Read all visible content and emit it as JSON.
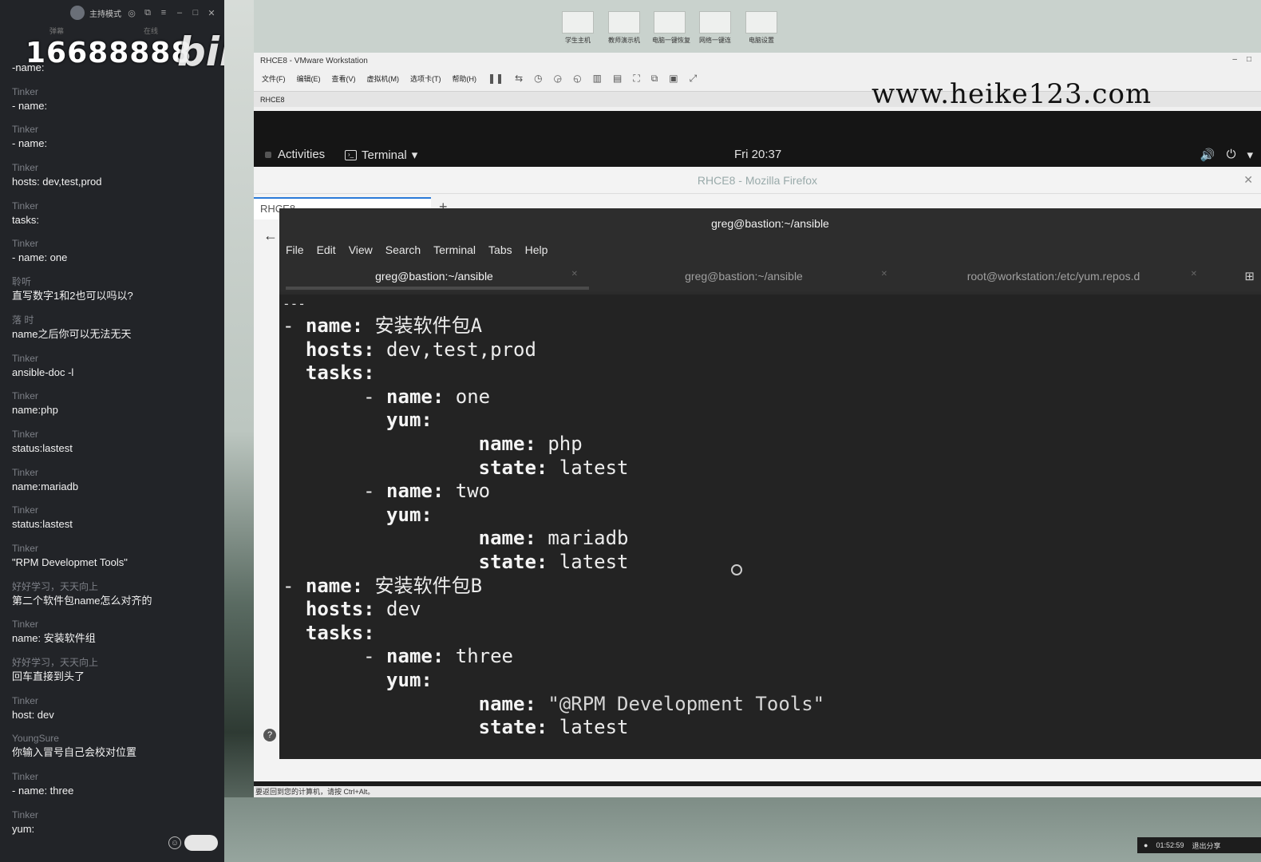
{
  "chat": {
    "host_label": "主持模式",
    "tabs": [
      "弹幕",
      "在线"
    ],
    "overlay_number": "16688888",
    "overlay_logo": "bili",
    "messages": [
      {
        "user": "",
        "text": "-name:"
      },
      {
        "user": "Tinker",
        "text": "- name:"
      },
      {
        "user": "Tinker",
        "text": "- name:"
      },
      {
        "user": "Tinker",
        "text": "hosts: dev,test,prod"
      },
      {
        "user": "Tinker",
        "text": "tasks:"
      },
      {
        "user": "Tinker",
        "text": "- name: one"
      },
      {
        "user": "聆听",
        "text": "直写数字1和2也可以吗以?"
      },
      {
        "user": "落 时",
        "text": "name之后你可以无法无天"
      },
      {
        "user": "Tinker",
        "text": "ansible-doc -l"
      },
      {
        "user": "Tinker",
        "text": "name:php"
      },
      {
        "user": "Tinker",
        "text": "status:lastest"
      },
      {
        "user": "Tinker",
        "text": "name:mariadb"
      },
      {
        "user": "Tinker",
        "text": "status:lastest"
      },
      {
        "user": "Tinker",
        "text": "\"RPM Developmet Tools\""
      },
      {
        "user": "好好学习，天天向上",
        "text": "第二个软件包name怎么对齐的"
      },
      {
        "user": "Tinker",
        "text": "name: 安装软件组"
      },
      {
        "user": "好好学习，天天向上",
        "text": "回车直接到头了"
      },
      {
        "user": "Tinker",
        "text": "host: dev"
      },
      {
        "user": "YoungSure",
        "text": "你输入冒号自己会校对位置"
      },
      {
        "user": "Tinker",
        "text": "- name: three"
      },
      {
        "user": "Tinker",
        "text": "yum:"
      }
    ]
  },
  "desktop_icons": [
    "学生主机",
    "教师演示机",
    "电脑一键恢复",
    "网络一键连",
    "电脑设置"
  ],
  "vmware": {
    "title": "RHCE8 - VMware Workstation",
    "menu": [
      "文件(F)",
      "编辑(E)",
      "查看(V)",
      "虚拟机(M)",
      "选项卡(T)",
      "帮助(H)"
    ],
    "tab": "RHCE8",
    "watermark": "www.heike123.com",
    "status": "要返回到您的计算机，请按 Ctrl+Alt。"
  },
  "gnome": {
    "activities": "Activities",
    "app_menu": "Terminal",
    "clock": "Fri 20:37"
  },
  "firefox": {
    "title": "RHCE8 - Mozilla Firefox",
    "tab": "RHCE8"
  },
  "terminal": {
    "title": "greg@bastion:~/ansible",
    "menu": [
      "File",
      "Edit",
      "View",
      "Search",
      "Terminal",
      "Tabs",
      "Help"
    ],
    "tabs": [
      "greg@bastion:~/ansible",
      "greg@bastion:~/ansible",
      "root@workstation:/etc/yum.repos.d"
    ],
    "lines": [
      {
        "text": "---"
      },
      {
        "prefix": "- ",
        "key": "name",
        "value": " 安装软件包A"
      },
      {
        "prefix": "  ",
        "key": "hosts",
        "value": " dev,test,prod"
      },
      {
        "prefix": "  ",
        "key": "tasks",
        "value": ""
      },
      {
        "prefix": "       - ",
        "key": "name",
        "value": " one"
      },
      {
        "prefix": "         ",
        "key": "yum",
        "value": ""
      },
      {
        "prefix": "                 ",
        "key": "name",
        "value": " php"
      },
      {
        "prefix": "                 ",
        "key": "state",
        "value": " latest"
      },
      {
        "prefix": "       - ",
        "key": "name",
        "value": " two"
      },
      {
        "prefix": "         ",
        "key": "yum",
        "value": ""
      },
      {
        "prefix": "                 ",
        "key": "name",
        "value": " mariadb"
      },
      {
        "prefix": "                 ",
        "key": "state",
        "value": " latest"
      },
      {
        "prefix": "- ",
        "key": "name",
        "value": " 安装软件包B"
      },
      {
        "prefix": "  ",
        "key": "hosts",
        "value": " dev"
      },
      {
        "prefix": "  ",
        "key": "tasks",
        "value": ""
      },
      {
        "prefix": "       - ",
        "key": "name",
        "value": " three"
      },
      {
        "prefix": "         ",
        "key": "yum",
        "value": ""
      },
      {
        "prefix": "                 ",
        "key": "name",
        "value": " \"@RPM Development Tools\"",
        "quoted": true
      },
      {
        "prefix": "                 ",
        "key": "state",
        "value": " latest"
      }
    ]
  },
  "tray": {
    "time": "01:52:59",
    "share": "退出分享"
  }
}
